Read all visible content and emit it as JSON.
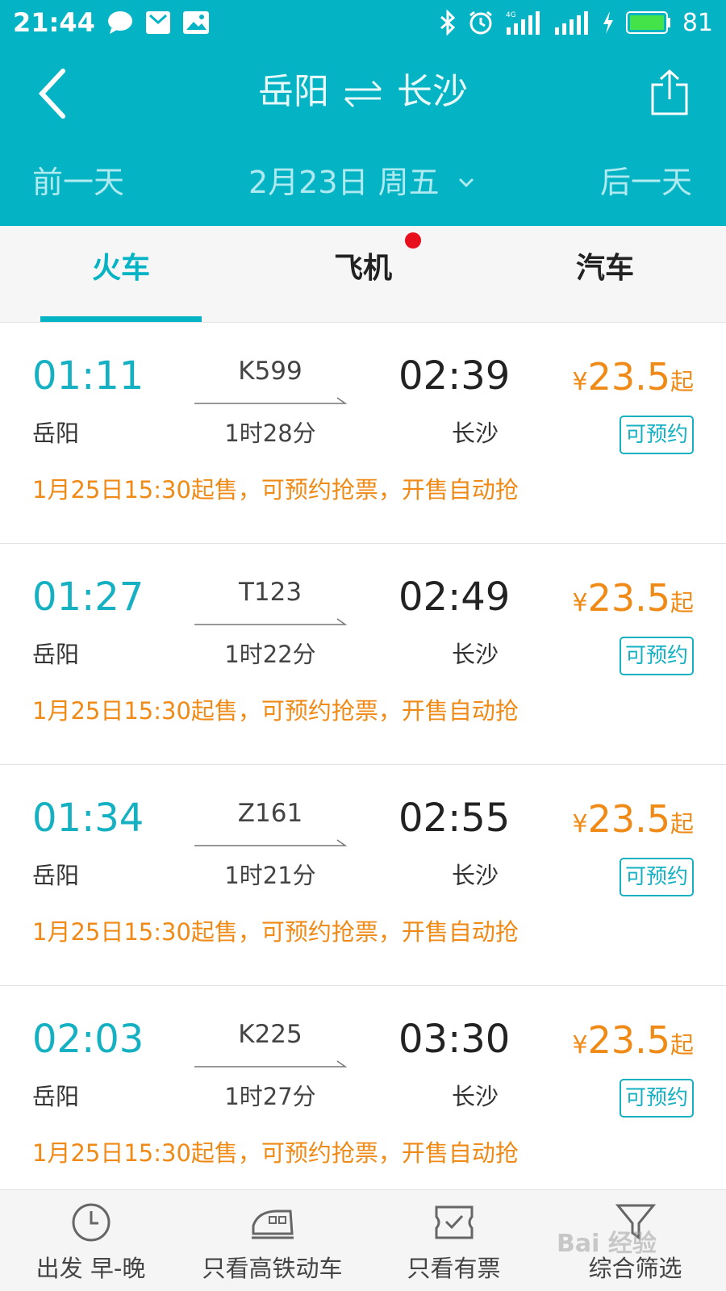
{
  "status_bar": {
    "time": "21:44",
    "battery": "81",
    "icons": [
      "chat-icon",
      "mail-icon",
      "image-icon",
      "bluetooth-icon",
      "alarm-icon",
      "4g-signal-icon",
      "signal-icon",
      "charging-icon",
      "battery-icon"
    ]
  },
  "header": {
    "route_from": "岳阳",
    "route_to": "长沙",
    "prev_day": "前一天",
    "date": "2月23日 周五",
    "next_day": "后一天",
    "accent": "#04b3c4"
  },
  "tabs": [
    {
      "label": "火车",
      "active": true
    },
    {
      "label": "飞机",
      "active": false,
      "dot": true
    },
    {
      "label": "汽车",
      "active": false
    }
  ],
  "trains": [
    {
      "dep_time": "01:11",
      "dep_station": "岳阳",
      "train_no": "K599",
      "duration": "1时28分",
      "arr_time": "02:39",
      "arr_station": "长沙",
      "currency": "¥",
      "price": "23.5",
      "price_suffix": "起",
      "status": "可预约",
      "note": "1月25日15:30起售，可预约抢票，开售自动抢"
    },
    {
      "dep_time": "01:27",
      "dep_station": "岳阳",
      "train_no": "T123",
      "duration": "1时22分",
      "arr_time": "02:49",
      "arr_station": "长沙",
      "currency": "¥",
      "price": "23.5",
      "price_suffix": "起",
      "status": "可预约",
      "note": "1月25日15:30起售，可预约抢票，开售自动抢"
    },
    {
      "dep_time": "01:34",
      "dep_station": "岳阳",
      "train_no": "Z161",
      "duration": "1时21分",
      "arr_time": "02:55",
      "arr_station": "长沙",
      "currency": "¥",
      "price": "23.5",
      "price_suffix": "起",
      "status": "可预约",
      "note": "1月25日15:30起售，可预约抢票，开售自动抢"
    },
    {
      "dep_time": "02:03",
      "dep_station": "岳阳",
      "train_no": "K225",
      "duration": "1时27分",
      "arr_time": "03:30",
      "arr_station": "长沙",
      "currency": "¥",
      "price": "23.5",
      "price_suffix": "起",
      "status": "可预约",
      "note": "1月25日15:30起售，可预约抢票，开售自动抢"
    }
  ],
  "bottom_bar": [
    {
      "label": "出发 早-晚",
      "icon": "clock-icon"
    },
    {
      "label": "只看高铁动车",
      "icon": "bullet-train-icon"
    },
    {
      "label": "只看有票",
      "icon": "ticket-check-icon"
    },
    {
      "label": "综合筛选",
      "icon": "filter-icon"
    }
  ],
  "watermark": "Bai 经验"
}
